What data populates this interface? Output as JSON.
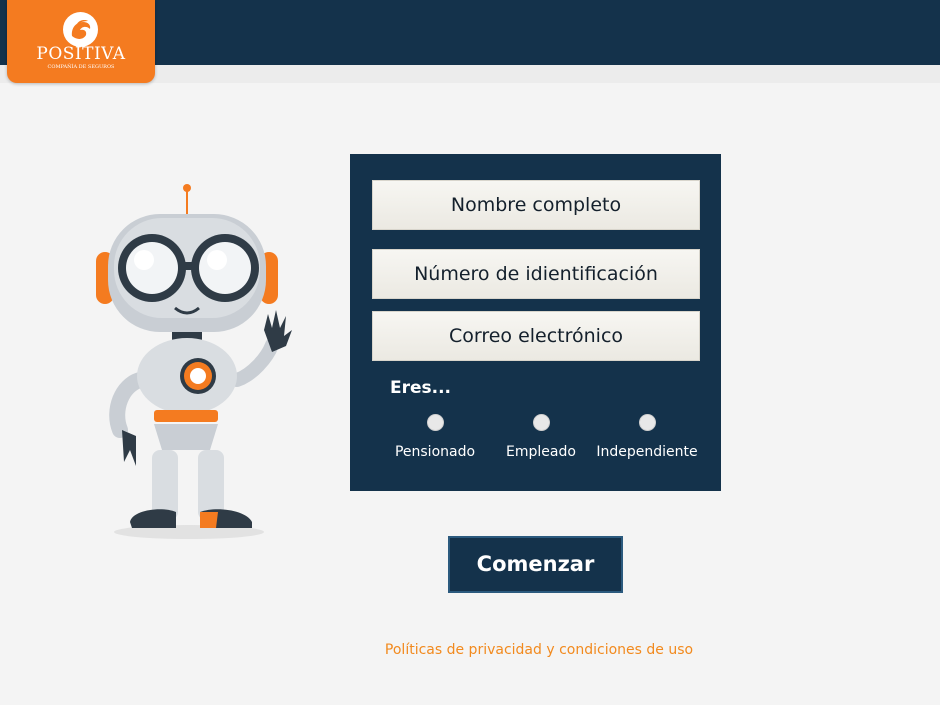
{
  "brand": {
    "name": "POSITIVA",
    "tagline": "COMPAÑÍA DE SEGUROS",
    "colors": {
      "navy": "#14324b",
      "orange": "#f47b20",
      "link_orange": "#f28a1e",
      "background": "#f4f4f4"
    }
  },
  "form": {
    "fields": [
      {
        "label": "Nombre completo"
      },
      {
        "label": "Número de idientificación"
      },
      {
        "label": "Correo electrónico"
      }
    ],
    "question": "Eres...",
    "options": [
      {
        "label": "Pensionado",
        "selected": false
      },
      {
        "label": "Empleado",
        "selected": false
      },
      {
        "label": "Independiente",
        "selected": false
      }
    ]
  },
  "actions": {
    "start_label": "Comenzar",
    "privacy_link": "Políticas de privacidad y condiciones de uso"
  },
  "icons": {
    "logo": "positiva-logo-icon",
    "mascot": "robot-mascot-icon"
  }
}
